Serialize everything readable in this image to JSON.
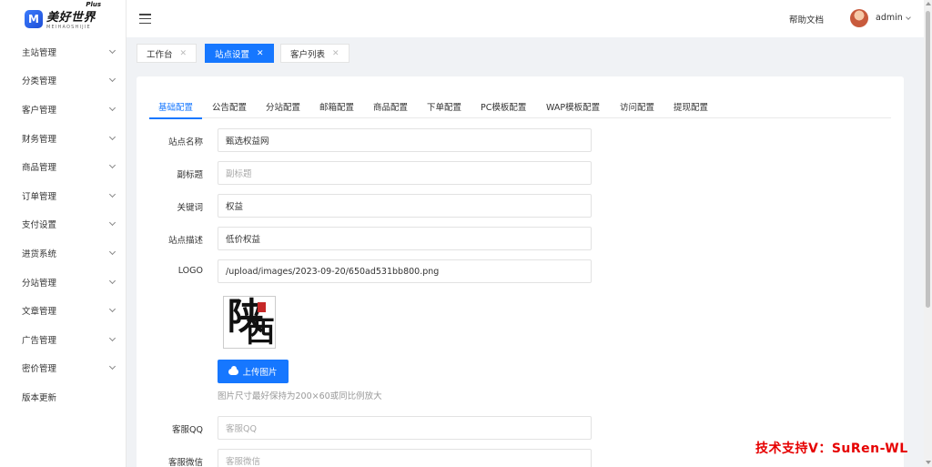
{
  "brand": {
    "cn": "美好世界",
    "plus": "Plus",
    "en": "MEIHAOSHIJIE",
    "mark": "M"
  },
  "sidebar": {
    "items": [
      {
        "label": "主站管理",
        "expandable": true
      },
      {
        "label": "分类管理",
        "expandable": true
      },
      {
        "label": "客户管理",
        "expandable": true
      },
      {
        "label": "财务管理",
        "expandable": true
      },
      {
        "label": "商品管理",
        "expandable": true
      },
      {
        "label": "订单管理",
        "expandable": true
      },
      {
        "label": "支付设置",
        "expandable": true
      },
      {
        "label": "进货系统",
        "expandable": true
      },
      {
        "label": "分站管理",
        "expandable": true
      },
      {
        "label": "文章管理",
        "expandable": true
      },
      {
        "label": "广告管理",
        "expandable": true
      },
      {
        "label": "密价管理",
        "expandable": true
      },
      {
        "label": "版本更新",
        "expandable": false
      }
    ]
  },
  "header": {
    "help": "帮助文档",
    "user": "admin"
  },
  "open_tabs": [
    {
      "label": "工作台",
      "active": false
    },
    {
      "label": "站点设置",
      "active": true
    },
    {
      "label": "客户列表",
      "active": false
    }
  ],
  "config_tabs": [
    "基础配置",
    "公告配置",
    "分站配置",
    "邮箱配置",
    "商品配置",
    "下单配置",
    "PC模板配置",
    "WAP模板配置",
    "访问配置",
    "提现配置"
  ],
  "form": {
    "site_name": {
      "label": "站点名称",
      "value": "甄选权益网",
      "placeholder": ""
    },
    "subtitle": {
      "label": "副标题",
      "value": "",
      "placeholder": "副标题"
    },
    "keywords": {
      "label": "关键词",
      "value": "权益",
      "placeholder": ""
    },
    "description": {
      "label": "站点描述",
      "value": "低价权益",
      "placeholder": ""
    },
    "logo": {
      "label": "LOGO",
      "value": "/upload/images/2023-09-20/650ad531bb800.png",
      "placeholder": ""
    },
    "logo_preview_text": {
      "top": "陕",
      "bottom": "西"
    },
    "upload_button": "上传图片",
    "upload_hint": "图片尺寸最好保持为200×60或同比例放大",
    "service_qq": {
      "label": "客服QQ",
      "value": "",
      "placeholder": "客服QQ"
    },
    "service_wechat": {
      "label": "客服微信",
      "value": "",
      "placeholder": "客服微信"
    }
  },
  "watermark": "技术支持V：SuRen-WL",
  "colors": {
    "primary": "#1677ff",
    "watermark": "#e60000"
  }
}
